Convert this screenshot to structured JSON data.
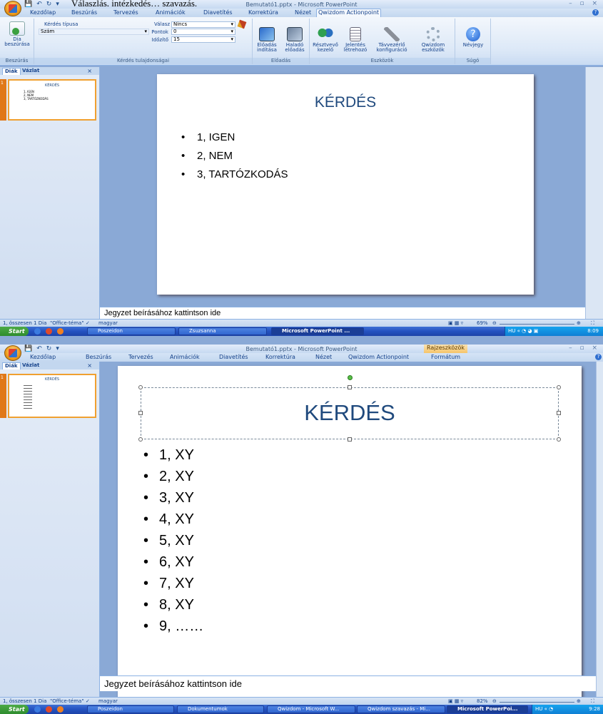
{
  "doc_line": "Válaszlás, intézkedés… szavazás.",
  "win1": {
    "title": "Bemutató1.pptx - Microsoft PowerPoint",
    "tabs": [
      "Kezdőlap",
      "Beszúrás",
      "Tervezés",
      "Animációk",
      "Diavetítés",
      "Korrektúra",
      "Nézet",
      "Qwizdom Actionpoint"
    ],
    "active_tab": "Qwizdom Actionpoint",
    "ribbon": {
      "insert_btn": "Dia beszúrása",
      "insert_group": "Beszúrás",
      "q_type_label": "Kérdés típusa",
      "q_type_value": "Szám",
      "answer_label": "Válasz",
      "answer_value": "Nincs",
      "points_label": "Pontok",
      "points_value": "0",
      "timer_label": "Időzítő",
      "timer_value": "15",
      "props_group": "Kérdés tulajdonságai",
      "start_btn": "Előadás indítása",
      "adv_btn": "Haladó előadás",
      "pres_group": "Előadás",
      "part_btn": "Résztvevő kezelő",
      "report_btn": "Jelentés létrehozó",
      "remote_btn": "Távvezérlő konfiguráció",
      "tools_btn": "Qwizdom eszközök",
      "tools_group": "Eszközök",
      "about_btn": "Névjegy",
      "help_group": "Súgó"
    },
    "left_tabs": [
      "Diák",
      "Vázlat"
    ],
    "thumb_num": "1",
    "thumb_title": "KÉRDÉS",
    "thumb_lines": [
      "1, IGEN",
      "2, NEM",
      "3, TARTÓZKODÁS"
    ],
    "slide_title": "KÉRDÉS",
    "bullets": [
      "1, IGEN",
      "2, NEM",
      "3, TARTÓZKODÁS"
    ],
    "notes": "Jegyzet beírásához kattintson ide",
    "status_left": "1, összesen 1 Dia",
    "status_theme": "\"Office-téma\"",
    "status_lang": "magyar",
    "zoom": "69%",
    "taskbar": {
      "start": "Start",
      "btns": [
        "Poszeidon",
        "Zsuzsanna",
        "Microsoft PowerPoint ..."
      ],
      "time": "8:09"
    }
  },
  "win2": {
    "title": "Bemutató1.pptx - Microsoft PowerPoint",
    "context_label": "Rajzeszközök",
    "tabs": [
      "Kezdőlap",
      "Beszúrás",
      "Tervezés",
      "Animációk",
      "Diavetítés",
      "Korrektúra",
      "Nézet",
      "Qwizdom Actionpoint",
      "Formátum"
    ],
    "left_tabs": [
      "Diák",
      "Vázlat"
    ],
    "thumb_num": "1",
    "thumb_title": "KÉRDÉS",
    "slide_title": "KÉRDÉS",
    "bullets": [
      "1, XY",
      "2, XY",
      "3, XY",
      "4, XY",
      "5, XY",
      "6, XY",
      "7, XY",
      "8, XY",
      "9, ……"
    ],
    "notes": "Jegyzet beírásához kattintson ide",
    "status_left": "1, összesen 1 Dia",
    "status_theme": "\"Office-téma\"",
    "status_lang": "magyar",
    "zoom": "82%",
    "taskbar": {
      "start": "Start",
      "btns": [
        "Poszeidon",
        "Dokumentumok",
        "Qwizdom - Microsoft W...",
        "Qwizdom szavazás - Mi...",
        "Microsoft PowerPoi..."
      ],
      "time": "9:28"
    }
  }
}
